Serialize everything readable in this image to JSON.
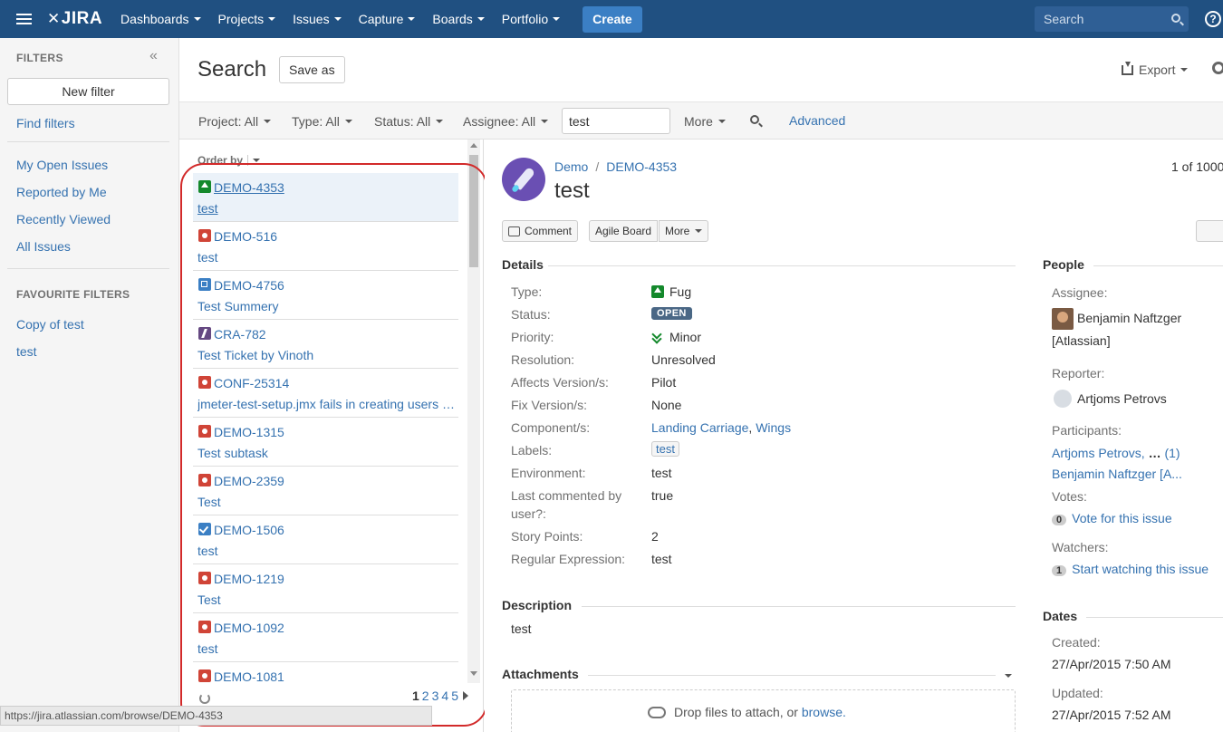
{
  "nav": {
    "logo": "JIRA",
    "items": [
      "Dashboards",
      "Projects",
      "Issues",
      "Capture",
      "Boards",
      "Portfolio"
    ],
    "create_label": "Create",
    "search_placeholder": "Search"
  },
  "sidebar": {
    "heading": "FILTERS",
    "new_filter": "New filter",
    "find_filters": "Find filters",
    "links": [
      "My Open Issues",
      "Reported by Me",
      "Recently Viewed",
      "All Issues"
    ],
    "favourite_heading": "FAVOURITE FILTERS",
    "favourites": [
      "Copy of test",
      "test"
    ]
  },
  "header": {
    "title": "Search",
    "save_as": "Save as",
    "export": "Export"
  },
  "filterbar": {
    "project": "Project: All",
    "type": "Type: All",
    "status": "Status: All",
    "assignee": "Assignee: All",
    "query": "test",
    "more": "More",
    "advanced": "Advanced"
  },
  "list": {
    "order_by": "Order by",
    "issues": [
      {
        "key": "DEMO-4353",
        "summary": "test",
        "type": "improvement"
      },
      {
        "key": "DEMO-516",
        "summary": "test",
        "type": "bug"
      },
      {
        "key": "DEMO-4756",
        "summary": "Test Summery",
        "type": "subtask"
      },
      {
        "key": "CRA-782",
        "summary": "Test Ticket by Vinoth",
        "type": "epic"
      },
      {
        "key": "CONF-25314",
        "summary": "jmeter-test-setup.jmx fails in creating users with new signup",
        "type": "bug"
      },
      {
        "key": "DEMO-1315",
        "summary": "Test subtask",
        "type": "bug"
      },
      {
        "key": "DEMO-2359",
        "summary": "Test",
        "type": "bug"
      },
      {
        "key": "DEMO-1506",
        "summary": "test",
        "type": "task"
      },
      {
        "key": "DEMO-1219",
        "summary": "Test",
        "type": "bug"
      },
      {
        "key": "DEMO-1092",
        "summary": "test",
        "type": "bug"
      },
      {
        "key": "DEMO-1081",
        "summary": "",
        "type": "bug"
      }
    ],
    "pages": [
      "1",
      "2",
      "3",
      "4",
      "5"
    ],
    "status_url": "https://jira.atlassian.com/browse/DEMO-4353"
  },
  "detail": {
    "project": "Demo",
    "key": "DEMO-4353",
    "title": "test",
    "count": "1 of 1000",
    "buttons": {
      "comment": "Comment",
      "agile": "Agile Board",
      "more": "More"
    },
    "details_heading": "Details",
    "fields": {
      "type_label": "Type:",
      "type_value": "Fug",
      "status_label": "Status:",
      "status_value": "OPEN",
      "priority_label": "Priority:",
      "priority_value": "Minor",
      "resolution_label": "Resolution:",
      "resolution_value": "Unresolved",
      "affects_label": "Affects Version/s:",
      "affects_value": "Pilot",
      "fix_label": "Fix Version/s:",
      "fix_value": "None",
      "component_label": "Component/s:",
      "component_a": "Landing Carriage",
      "component_b": "Wings",
      "labels_label": "Labels:",
      "labels_value": "test",
      "env_label": "Environment:",
      "env_value": "test",
      "lastcomm_label_1": "Last commented by",
      "lastcomm_label_2": "user?:",
      "lastcomm_value": "true",
      "story_label": "Story Points:",
      "story_value": "2",
      "regex_label": "Regular Expression:",
      "regex_value": "test"
    },
    "description_heading": "Description",
    "description": "test",
    "attachments_heading": "Attachments",
    "drop_text": "Drop files to attach, or",
    "browse": "browse."
  },
  "people": {
    "heading": "People",
    "assignee_label": "Assignee:",
    "assignee_name": "Benjamin Naftzger",
    "assignee_org": "[Atlassian]",
    "reporter_label": "Reporter:",
    "reporter_name": "Artjoms Petrovs",
    "participants_label": "Participants:",
    "participant_1": "Artjoms Petrovs,",
    "participant_more": "(1)",
    "participant_2": "Benjamin Naftzger [A...",
    "votes_label": "Votes:",
    "votes_count": "0",
    "vote_link": "Vote for this issue",
    "watchers_label": "Watchers:",
    "watchers_count": "1",
    "watch_link": "Start watching this issue"
  },
  "dates": {
    "heading": "Dates",
    "created_label": "Created:",
    "created_value": "27/Apr/2015 7:50 AM",
    "updated_label": "Updated:",
    "updated_value": "27/Apr/2015 7:52 AM"
  }
}
